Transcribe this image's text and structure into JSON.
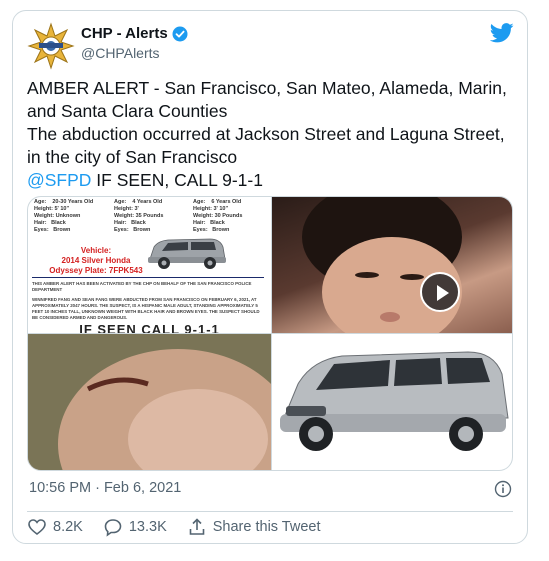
{
  "author": {
    "display_name": "CHP - Alerts",
    "handle": "@CHPAlerts"
  },
  "tweet": {
    "text_main": "AMBER ALERT - San Francisco, San Mateo, Alameda, Marin, and Santa Clara Counties\nThe abduction occurred at Jackson Street and Laguna Street, in the city of San Francisco\n",
    "mention": "@SFPD",
    "text_tail": " IF SEEN, CALL 9-1-1"
  },
  "media": {
    "poster": {
      "col1": "Age:    20-30 Years Old\nHeight: 5' 10\"\nWeight: Unknown\nHair:   Black\nEyes:   Brown",
      "col2": "Age:    4 Years Old\nHeight: 3'\nWeight: 35 Pounds\nHair:   Black\nEyes:   Brown",
      "col3": "Age:    6 Years Old\nHeight: 3' 10\"\nWeight: 30 Pounds\nHair:   Black\nEyes:   Brown",
      "vehicle": "Vehicle:\n2014 Silver Honda\nOdyssey Plate: 7FPK543",
      "note1": "THIS AMBER ALERT HAS BEEN ACTIVATED BY THE CHP ON BEHALF OF THE SAN FRANCISCO POLICE DEPARTMENT",
      "note2": "WINNIFRED FANG AND SEAN FANG WERE ABDUCTED FROM SAN FRANCISCO ON FEBRUARY 6, 2021, AT APPROXIMATELY 2047 HOURS. THE SUSPECT, IS A HISPANIC MALE ADULT, STANDING APPROXIMATELY 5 FEET 10 INCHES TALL, UNKNOWN WEIGHT WITH BLACK HAIR AND BROWN EYES. THE SUSPECT SHOULD BE CONSIDERED ARMED AND DANGEROUS.",
      "footer": "IF SEEN CALL 9-1-1"
    }
  },
  "meta": {
    "timestamp": "10:56 PM · Feb 6, 2021"
  },
  "actions": {
    "likes": "8.2K",
    "replies": "13.3K",
    "share": "Share this Tweet"
  },
  "colors": {
    "accent": "#1d9bf0",
    "secondary_text": "#536471",
    "border": "#cfd9de",
    "badge_gold": "#e8b43a"
  }
}
